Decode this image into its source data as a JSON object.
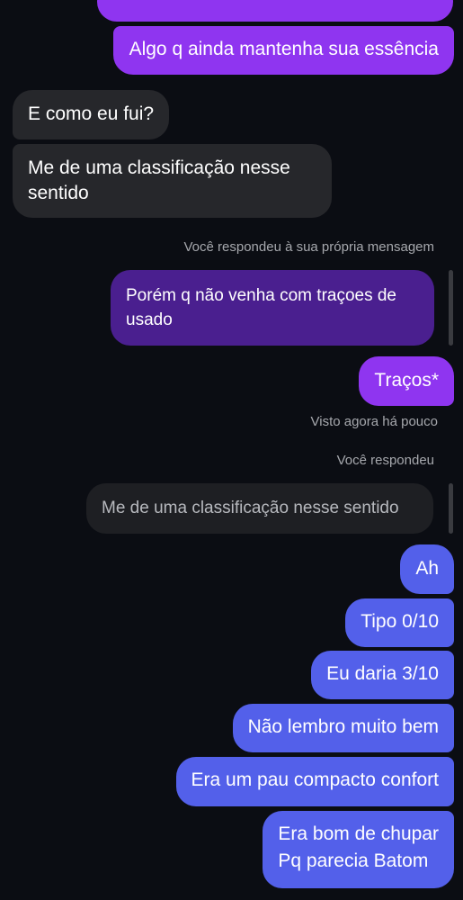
{
  "colors": {
    "background": "#0b0d13",
    "incoming_bubble": "#26272b",
    "outgoing_purple": "#8f35f0",
    "outgoing_quoted": "#4a1f8f",
    "outgoing_blue": "#5360ea",
    "quoted_incoming": "#1e1f23",
    "meta_text": "#a6a8ad"
  },
  "conversation": {
    "top_bubble_continuation": "",
    "msg_essencia": "Algo q ainda mantenha sua essência",
    "msg_como_eu_fui": "E como eu fui?",
    "msg_classificacao_line1": "Me de uma classificação nesse",
    "msg_classificacao_line2": "sentido",
    "reply_label_own": "Você respondeu à sua própria mensagem",
    "msg_porem_line1": "Porém q não venha com traçoes de",
    "msg_porem_line2": "usado",
    "msg_tracos": "Traços*",
    "seen_status": "Visto agora há pouco",
    "reply_label": "Você respondeu",
    "quoted_classificacao": "Me de uma classificação nesse sentido",
    "msg_ah": "Ah",
    "msg_tipo": "Tipo 0/10",
    "msg_daria": "Eu daria 3/10",
    "msg_nao_lembro": "Não lembro muito bem",
    "msg_era_pau": "Era um pau compacto confort",
    "msg_chupar_line1": "Era bom de chupar",
    "msg_chupar_line2": "Pq parecia Batom"
  }
}
